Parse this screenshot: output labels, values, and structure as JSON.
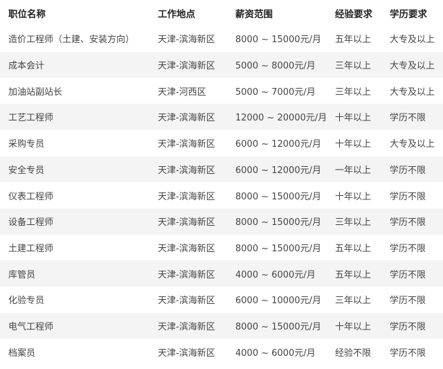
{
  "headers": {
    "title": "职位名称",
    "location": "工作地点",
    "salary": "薪资范围",
    "experience": "经验要求",
    "education": "学历要求"
  },
  "rows": [
    {
      "title": "造价工程师（土建、安装方向）",
      "location": "天津-滨海新区",
      "salary": "8000 ~ 15000元/月",
      "experience": "五年以上",
      "education": "大专及以上"
    },
    {
      "title": "成本会计",
      "location": "天津-滨海新区",
      "salary": "5000 ~ 8000元/月",
      "experience": "三年以上",
      "education": "大专及以上"
    },
    {
      "title": "加油站副站长",
      "location": "天津-河西区",
      "salary": "5000 ~ 7000元/月",
      "experience": "三年以上",
      "education": "大专及以上"
    },
    {
      "title": "工艺工程师",
      "location": "天津-滨海新区",
      "salary": "12000 ~ 20000元/月",
      "experience": "十年以上",
      "education": "学历不限"
    },
    {
      "title": "采购专员",
      "location": "天津-滨海新区",
      "salary": "6000 ~ 12000元/月",
      "experience": "十年以上",
      "education": "大专及以上"
    },
    {
      "title": "安全专员",
      "location": "天津-滨海新区",
      "salary": "6000 ~ 12000元/月",
      "experience": "一年以上",
      "education": "学历不限"
    },
    {
      "title": "仪表工程师",
      "location": "天津-滨海新区",
      "salary": "8000 ~ 15000元/月",
      "experience": "十年以上",
      "education": "学历不限"
    },
    {
      "title": "设备工程师",
      "location": "天津-滨海新区",
      "salary": "8000 ~ 15000元/月",
      "experience": "三年以上",
      "education": "学历不限"
    },
    {
      "title": "土建工程师",
      "location": "天津-滨海新区",
      "salary": "8000 ~ 15000元/月",
      "experience": "五年以上",
      "education": "学历不限"
    },
    {
      "title": "库管员",
      "location": "天津-滨海新区",
      "salary": "4000 ~ 6000元/月",
      "experience": "五年以上",
      "education": "学历不限"
    },
    {
      "title": "化验专员",
      "location": "天津-滨海新区",
      "salary": "6000 ~ 10000元/月",
      "experience": "三年以上",
      "education": "学历不限"
    },
    {
      "title": "电气工程师",
      "location": "天津-滨海新区",
      "salary": "8000 ~ 15000元/月",
      "experience": "十年以上",
      "education": "学历不限"
    },
    {
      "title": "档案员",
      "location": "天津-滨海新区",
      "salary": "4000 ~ 6000元/月",
      "experience": "经验不限",
      "education": "学历不限"
    }
  ]
}
